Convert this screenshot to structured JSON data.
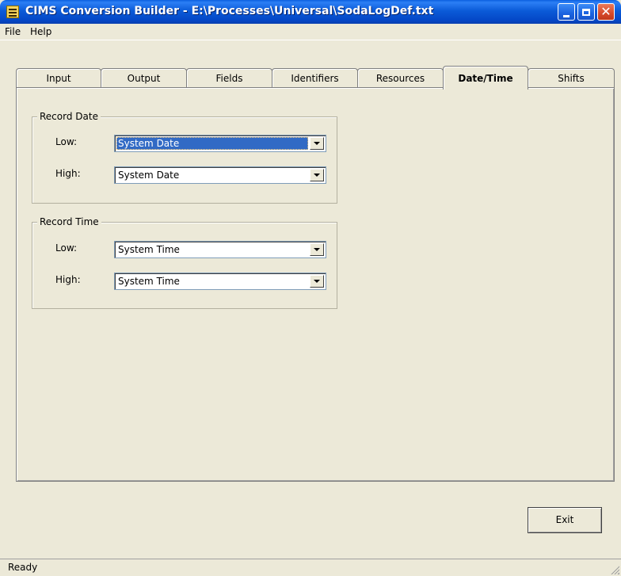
{
  "window": {
    "title": "CIMS Conversion Builder - E:\\Processes\\Universal\\SodaLogDef.txt",
    "icon": "app-icon",
    "controls": {
      "minimize": "minimize-icon",
      "maximize": "maximize-icon",
      "close": "✕"
    }
  },
  "menu": {
    "items": [
      "File",
      "Help"
    ]
  },
  "tabs": {
    "items": [
      "Input",
      "Output",
      "Fields",
      "Identifiers",
      "Resources",
      "Date/Time",
      "Shifts"
    ],
    "active": "Date/Time"
  },
  "record_date": {
    "legend": "Record Date",
    "low_label": "Low:",
    "low_value": "System Date",
    "high_label": "High:",
    "high_value": "System Date"
  },
  "record_time": {
    "legend": "Record Time",
    "low_label": "Low:",
    "low_value": "System Time",
    "high_label": "High:",
    "high_value": "System Time"
  },
  "buttons": {
    "exit": "Exit"
  },
  "status": {
    "text": "Ready"
  },
  "colors": {
    "titlebar": "#0447c7",
    "window_bg": "#ece9d8",
    "selection": "#316ac5",
    "close_button": "#d6492a"
  }
}
